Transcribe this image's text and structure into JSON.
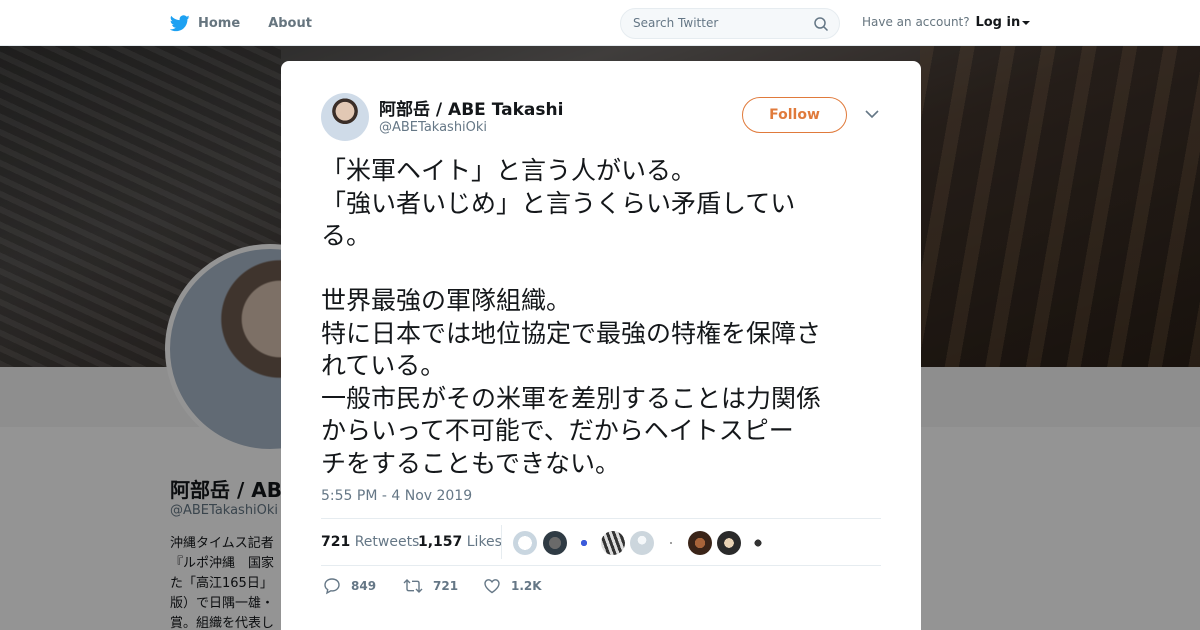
{
  "nav": {
    "home_label": "Home",
    "about_label": "About",
    "search_placeholder": "Search Twitter",
    "account_prompt": "Have an account?",
    "login_label": "Log in"
  },
  "profile": {
    "name": "阿部岳 / ABE Takashi",
    "handle": "@ABETakashiOki",
    "bio_visible": "沖縄タイムス記者\n『ルポ沖縄　国家\nた「高江165日」\n版）で日隅一雄・\n賞。組織を代表し"
  },
  "tweet": {
    "author_name": "阿部岳 / ABE Takashi",
    "author_handle": "@ABETakashiOki",
    "follow_label": "Follow",
    "text": "「米軍ヘイト」と言う人がいる。\n「強い者いじめ」と言うくらい矛盾してい\nる。\n\n世界最強の軍隊組織。\n特に日本では地位協定で最強の特権を保障さ\nれている。\n一般市民がその米軍を差別することは力関係\nからいって不可能で、だからヘイトスピー\nチをすることもできない。",
    "timestamp": "5:55 PM - 4 Nov 2019",
    "retweets_count": "721",
    "retweets_label": "Retweets",
    "likes_count": "1,157",
    "likes_label": "Likes",
    "reply_count": "849",
    "retweet_action_count": "721",
    "like_action_count": "1.2K"
  },
  "colors": {
    "accent": "#e07a3b",
    "twitter_blue": "#1da1f2",
    "muted": "#657786"
  }
}
